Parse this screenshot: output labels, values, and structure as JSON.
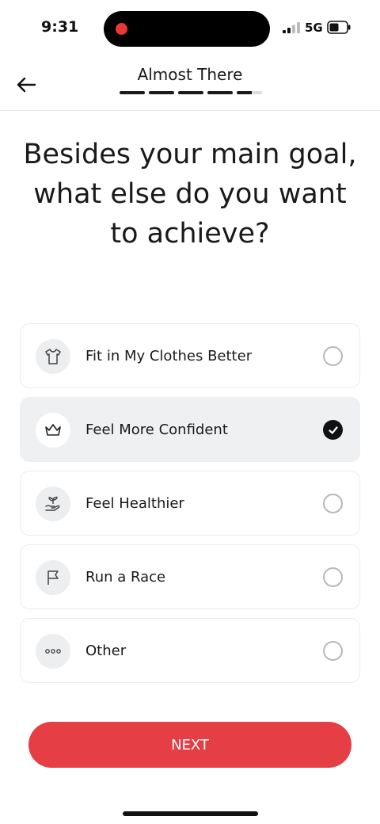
{
  "status_bar": {
    "time": "9:31",
    "network": "5G"
  },
  "header": {
    "title": "Almost There",
    "progress_segments": 5,
    "progress_fraction": 0.93
  },
  "question": "Besides your main goal, what else do you want to achieve?",
  "options": [
    {
      "label": "Fit in My Clothes Better",
      "icon": "tshirt-icon",
      "selected": false
    },
    {
      "label": "Feel More Confident",
      "icon": "crown-icon",
      "selected": true
    },
    {
      "label": "Feel Healthier",
      "icon": "hand-sprout-icon",
      "selected": false
    },
    {
      "label": "Run a Race",
      "icon": "flag-icon",
      "selected": false
    },
    {
      "label": "Other",
      "icon": "more-dots-icon",
      "selected": false
    }
  ],
  "next_label": "NEXT",
  "colors": {
    "accent": "#e53e44",
    "selected_bg": "#eef0f2",
    "text": "#1a1a1a"
  }
}
